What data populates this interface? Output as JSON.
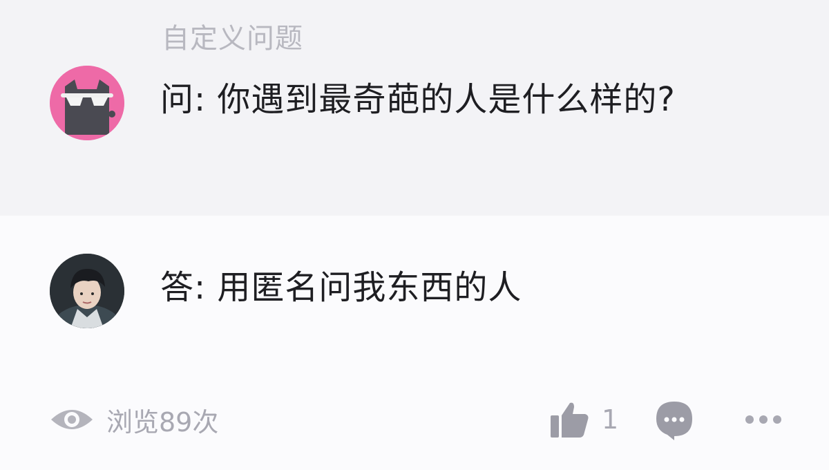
{
  "question": {
    "category": "自定义问题",
    "text": "问: 你遇到最奇葩的人是什么样的?"
  },
  "answer": {
    "text": "答: 用匿名问我东西的人"
  },
  "footer": {
    "views_label": "浏览89次",
    "like_count": "1"
  },
  "icons": {
    "views": "eye-icon",
    "like": "thumbs-up-icon",
    "comment": "comment-bubble-icon",
    "more": "more-dots-icon"
  },
  "colors": {
    "question_bg": "#f3f3f6",
    "avatar_pink": "#ee6aa7",
    "muted_gray": "#a8a8b2"
  }
}
